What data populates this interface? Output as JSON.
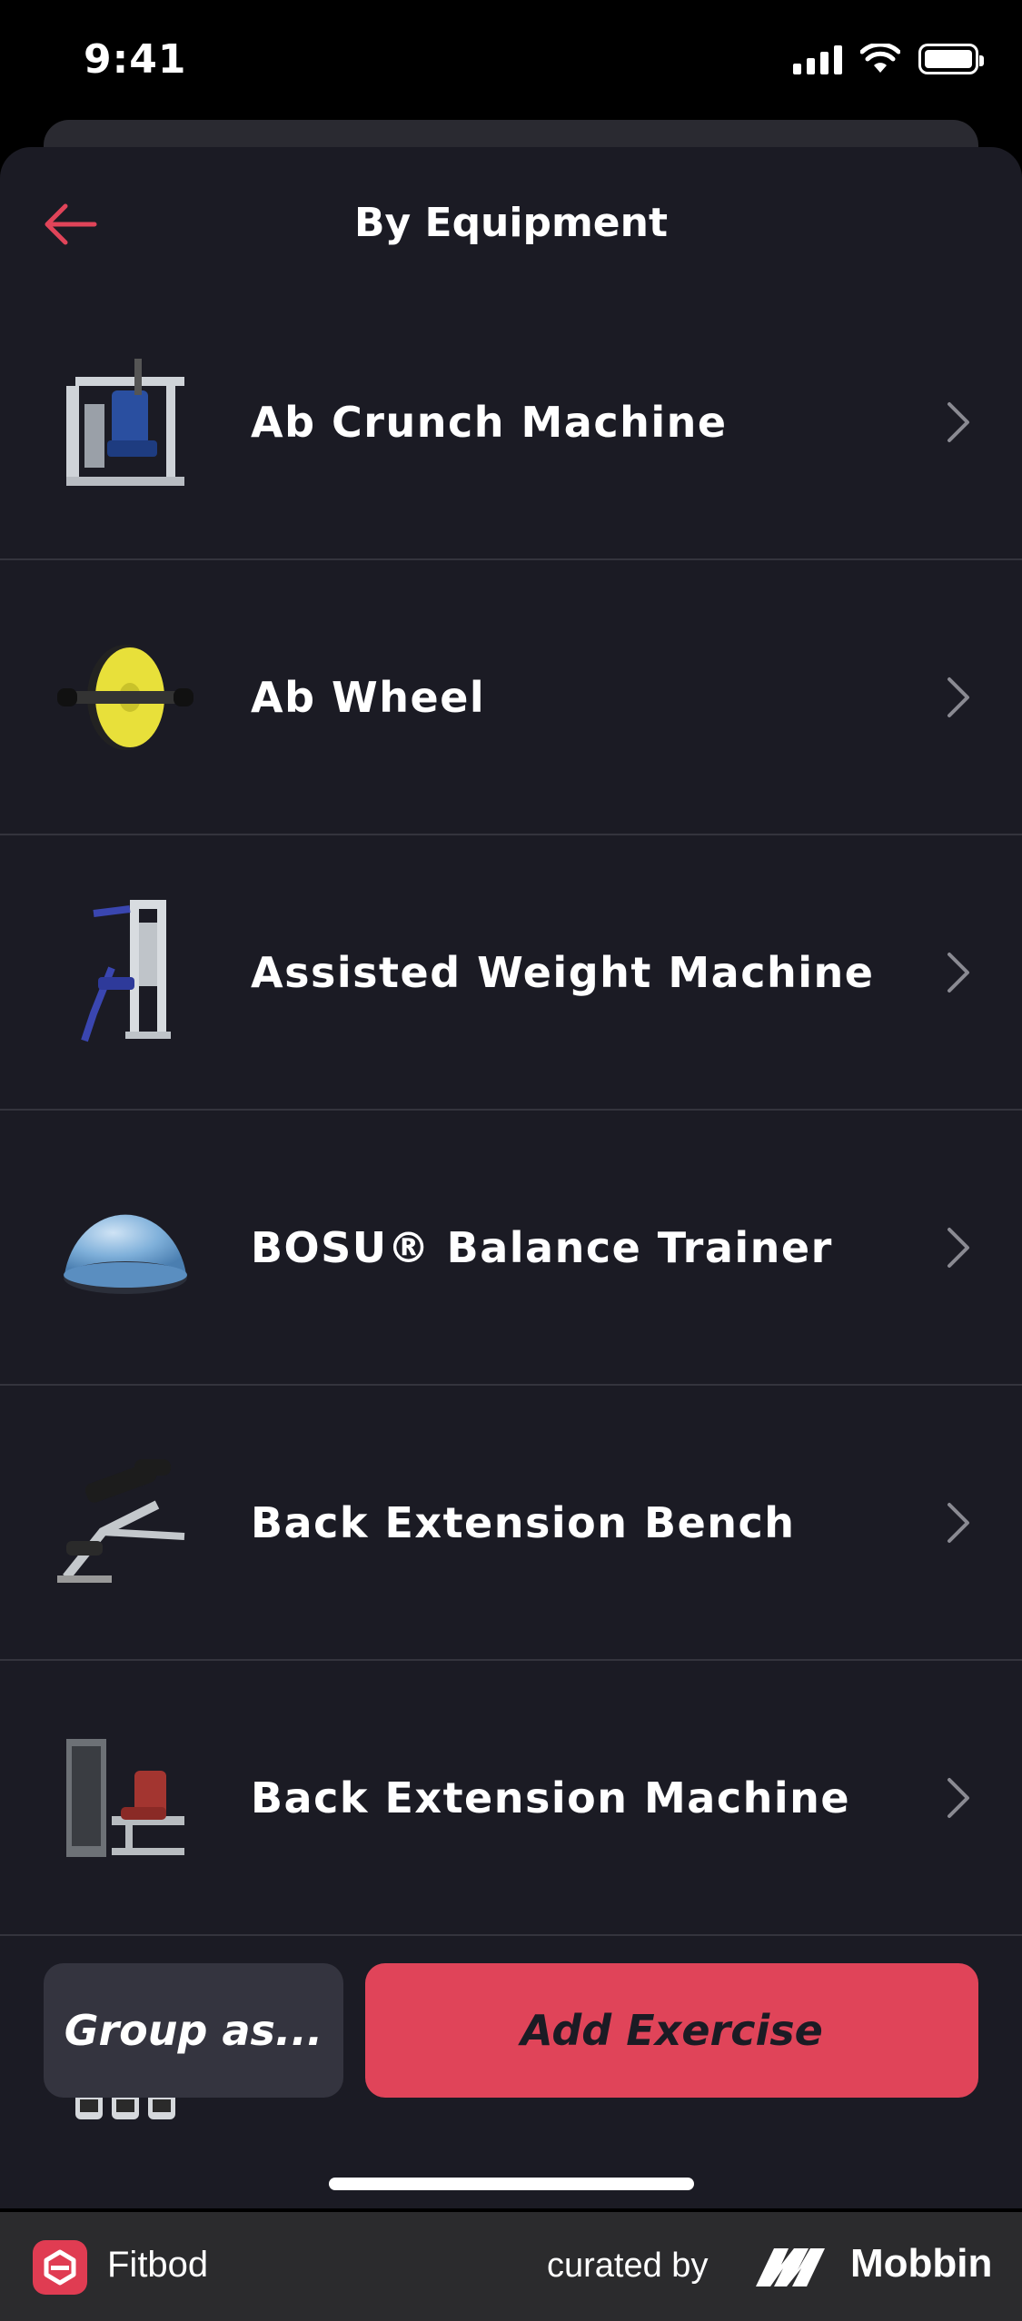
{
  "status_bar": {
    "time": "9:41"
  },
  "nav": {
    "title": "By Equipment",
    "back_icon": "arrow-left-icon"
  },
  "equipment": [
    {
      "label": "Ab Crunch Machine",
      "icon": "ab-crunch-machine-image"
    },
    {
      "label": "Ab Wheel",
      "icon": "ab-wheel-image"
    },
    {
      "label": "Assisted Weight Machine",
      "icon": "assisted-weight-machine-image"
    },
    {
      "label": "BOSU® Balance Trainer",
      "icon": "bosu-ball-image"
    },
    {
      "label": "Back Extension Bench",
      "icon": "back-extension-bench-image"
    },
    {
      "label": "Back Extension Machine",
      "icon": "back-extension-machine-image"
    }
  ],
  "actions": {
    "group_label": "Group as...",
    "add_label": "Add Exercise"
  },
  "footer": {
    "app_name": "Fitbod",
    "curated_by": "curated by",
    "brand": "Mobbin"
  },
  "colors": {
    "accent": "#e04459",
    "background": "#1b1b24",
    "divider": "#34343d"
  }
}
